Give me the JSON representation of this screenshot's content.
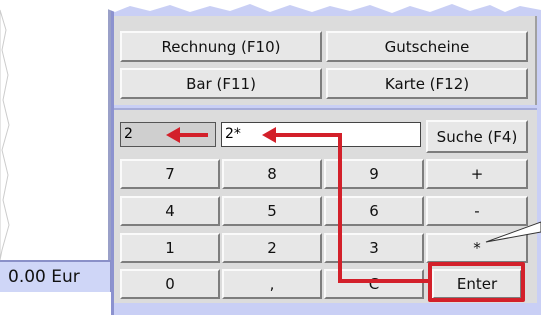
{
  "upper_buttons": {
    "invoice": "Rechnung (F10)",
    "vouchers": "Gutscheine",
    "cash": "Bar (F11)",
    "card": "Karte (F12)"
  },
  "total": "0.00 Eur",
  "input": {
    "quantity_display": "2",
    "search_value": "2*",
    "search_button": "Suche (F4)"
  },
  "keypad": {
    "rows": [
      [
        "7",
        "8",
        "9",
        "+"
      ],
      [
        "4",
        "5",
        "6",
        "-"
      ],
      [
        "1",
        "2",
        "3",
        "*"
      ],
      [
        "0",
        ",",
        "C",
        "Enter"
      ]
    ]
  },
  "colors": {
    "frame": "#c9cff5",
    "panel": "#dcdcdc",
    "annotation": "#d3202a"
  }
}
